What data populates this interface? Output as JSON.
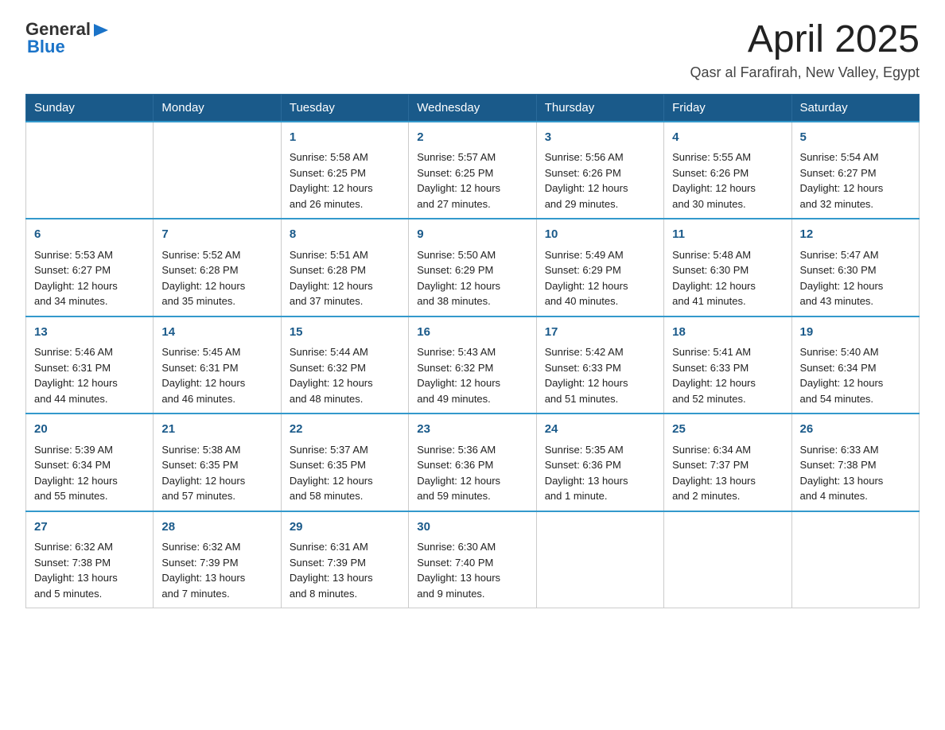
{
  "header": {
    "logo_general": "General",
    "logo_blue": "Blue",
    "title": "April 2025",
    "subtitle": "Qasr al Farafirah, New Valley, Egypt"
  },
  "calendar": {
    "days": [
      "Sunday",
      "Monday",
      "Tuesday",
      "Wednesday",
      "Thursday",
      "Friday",
      "Saturday"
    ],
    "weeks": [
      [
        {
          "day": "",
          "info": ""
        },
        {
          "day": "",
          "info": ""
        },
        {
          "day": "1",
          "info": "Sunrise: 5:58 AM\nSunset: 6:25 PM\nDaylight: 12 hours\nand 26 minutes."
        },
        {
          "day": "2",
          "info": "Sunrise: 5:57 AM\nSunset: 6:25 PM\nDaylight: 12 hours\nand 27 minutes."
        },
        {
          "day": "3",
          "info": "Sunrise: 5:56 AM\nSunset: 6:26 PM\nDaylight: 12 hours\nand 29 minutes."
        },
        {
          "day": "4",
          "info": "Sunrise: 5:55 AM\nSunset: 6:26 PM\nDaylight: 12 hours\nand 30 minutes."
        },
        {
          "day": "5",
          "info": "Sunrise: 5:54 AM\nSunset: 6:27 PM\nDaylight: 12 hours\nand 32 minutes."
        }
      ],
      [
        {
          "day": "6",
          "info": "Sunrise: 5:53 AM\nSunset: 6:27 PM\nDaylight: 12 hours\nand 34 minutes."
        },
        {
          "day": "7",
          "info": "Sunrise: 5:52 AM\nSunset: 6:28 PM\nDaylight: 12 hours\nand 35 minutes."
        },
        {
          "day": "8",
          "info": "Sunrise: 5:51 AM\nSunset: 6:28 PM\nDaylight: 12 hours\nand 37 minutes."
        },
        {
          "day": "9",
          "info": "Sunrise: 5:50 AM\nSunset: 6:29 PM\nDaylight: 12 hours\nand 38 minutes."
        },
        {
          "day": "10",
          "info": "Sunrise: 5:49 AM\nSunset: 6:29 PM\nDaylight: 12 hours\nand 40 minutes."
        },
        {
          "day": "11",
          "info": "Sunrise: 5:48 AM\nSunset: 6:30 PM\nDaylight: 12 hours\nand 41 minutes."
        },
        {
          "day": "12",
          "info": "Sunrise: 5:47 AM\nSunset: 6:30 PM\nDaylight: 12 hours\nand 43 minutes."
        }
      ],
      [
        {
          "day": "13",
          "info": "Sunrise: 5:46 AM\nSunset: 6:31 PM\nDaylight: 12 hours\nand 44 minutes."
        },
        {
          "day": "14",
          "info": "Sunrise: 5:45 AM\nSunset: 6:31 PM\nDaylight: 12 hours\nand 46 minutes."
        },
        {
          "day": "15",
          "info": "Sunrise: 5:44 AM\nSunset: 6:32 PM\nDaylight: 12 hours\nand 48 minutes."
        },
        {
          "day": "16",
          "info": "Sunrise: 5:43 AM\nSunset: 6:32 PM\nDaylight: 12 hours\nand 49 minutes."
        },
        {
          "day": "17",
          "info": "Sunrise: 5:42 AM\nSunset: 6:33 PM\nDaylight: 12 hours\nand 51 minutes."
        },
        {
          "day": "18",
          "info": "Sunrise: 5:41 AM\nSunset: 6:33 PM\nDaylight: 12 hours\nand 52 minutes."
        },
        {
          "day": "19",
          "info": "Sunrise: 5:40 AM\nSunset: 6:34 PM\nDaylight: 12 hours\nand 54 minutes."
        }
      ],
      [
        {
          "day": "20",
          "info": "Sunrise: 5:39 AM\nSunset: 6:34 PM\nDaylight: 12 hours\nand 55 minutes."
        },
        {
          "day": "21",
          "info": "Sunrise: 5:38 AM\nSunset: 6:35 PM\nDaylight: 12 hours\nand 57 minutes."
        },
        {
          "day": "22",
          "info": "Sunrise: 5:37 AM\nSunset: 6:35 PM\nDaylight: 12 hours\nand 58 minutes."
        },
        {
          "day": "23",
          "info": "Sunrise: 5:36 AM\nSunset: 6:36 PM\nDaylight: 12 hours\nand 59 minutes."
        },
        {
          "day": "24",
          "info": "Sunrise: 5:35 AM\nSunset: 6:36 PM\nDaylight: 13 hours\nand 1 minute."
        },
        {
          "day": "25",
          "info": "Sunrise: 6:34 AM\nSunset: 7:37 PM\nDaylight: 13 hours\nand 2 minutes."
        },
        {
          "day": "26",
          "info": "Sunrise: 6:33 AM\nSunset: 7:38 PM\nDaylight: 13 hours\nand 4 minutes."
        }
      ],
      [
        {
          "day": "27",
          "info": "Sunrise: 6:32 AM\nSunset: 7:38 PM\nDaylight: 13 hours\nand 5 minutes."
        },
        {
          "day": "28",
          "info": "Sunrise: 6:32 AM\nSunset: 7:39 PM\nDaylight: 13 hours\nand 7 minutes."
        },
        {
          "day": "29",
          "info": "Sunrise: 6:31 AM\nSunset: 7:39 PM\nDaylight: 13 hours\nand 8 minutes."
        },
        {
          "day": "30",
          "info": "Sunrise: 6:30 AM\nSunset: 7:40 PM\nDaylight: 13 hours\nand 9 minutes."
        },
        {
          "day": "",
          "info": ""
        },
        {
          "day": "",
          "info": ""
        },
        {
          "day": "",
          "info": ""
        }
      ]
    ]
  }
}
